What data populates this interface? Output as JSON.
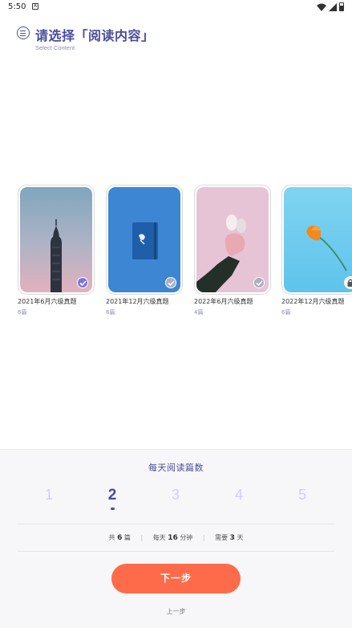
{
  "status_bar": {
    "time": "5:50",
    "notification_glyph": "A"
  },
  "header": {
    "title": "请选择「阅读内容」",
    "subtitle": "Select Content"
  },
  "cards": [
    {
      "title": "2021年6月六级真题",
      "count": "6篇",
      "state": "checked",
      "badge_color": "#7b74e0"
    },
    {
      "title": "2021年12月六级真题",
      "count": "6篇",
      "state": "checked",
      "badge_color": "#a9aec0"
    },
    {
      "title": "2022年6月六级真题",
      "count": "4篇",
      "state": "checked",
      "badge_color": "#a9aec0"
    },
    {
      "title": "2022年12月六级真题",
      "count": "6篇",
      "state": "locked",
      "badge_color": "#ffffff"
    }
  ],
  "panel": {
    "title": "每天阅读篇数",
    "options": [
      "1",
      "2",
      "3",
      "4",
      "5"
    ],
    "selected_index": 1,
    "stats": {
      "total_prefix": "共",
      "total_value": "6",
      "total_suffix": "篇",
      "daily_prefix": "每天",
      "daily_value": "16",
      "daily_suffix": "分钟",
      "days_prefix": "需要",
      "days_value": "3",
      "days_suffix": "天"
    },
    "next_label": "下一步",
    "prev_label": "上一步"
  },
  "colors": {
    "accent": "#4a4c9c",
    "button": "#fe6b4a",
    "muted": "#cfd1ea"
  }
}
